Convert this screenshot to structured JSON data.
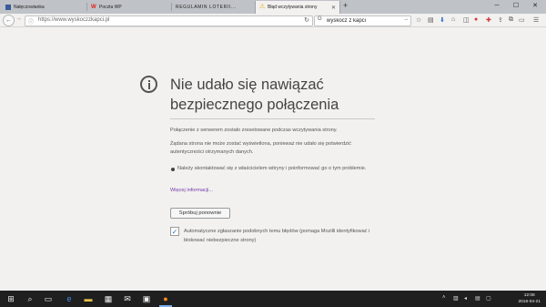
{
  "browser": {
    "tabs": [
      {
        "label": "Nałęczowianka",
        "favicon": "facebook-icon",
        "color": "#3b5998"
      },
      {
        "label": "Poczta WP",
        "favicon": "wp-icon",
        "color": "#e2231a"
      },
      {
        "label": "REGULAMIN LOTERII...",
        "favicon": "",
        "color": ""
      },
      {
        "label": "Błąd wczytywania strony",
        "favicon": "warning-icon",
        "color": "#e0a800"
      }
    ],
    "url": "https://www.wyskoczzkapci.pl",
    "search_value": "wyskocz z kapci",
    "window_controls": [
      "minimize-icon",
      "maximize-icon",
      "close-icon"
    ]
  },
  "error_page": {
    "title": "Nie udało się nawiązać bezpiecznego połączenia",
    "para1": "Połączenie z serwerem zostało zresetowane podczas wczytywania strony.",
    "para2": "Żądana strona nie może zostać wyświetlona, ponieważ nie udało się potwierdzić autentyczności otrzymanych danych.",
    "bullet1": "Należy skontaktować się z właścicielem witryny i poinformować go o tym problemie.",
    "more_info": "Więcej informacji...",
    "retry_button": "Spróbuj ponownie",
    "auto_report_checked": true,
    "auto_report_text": "Automatyczne zgłaszanie podobnych temu błędów (pomaga Mozilli identyfikować i blokować niebezpieczne strony)",
    "accent_link": "#7338a8"
  },
  "taskbar": {
    "clock_time": "12:08",
    "clock_date": "2016-04-21",
    "apps": [
      "windows-start-icon",
      "search-icon",
      "task-view-icon",
      "edge-icon",
      "file-explorer-icon",
      "calculator-icon",
      "mail-icon",
      "photos-icon",
      "firefox-icon"
    ]
  }
}
